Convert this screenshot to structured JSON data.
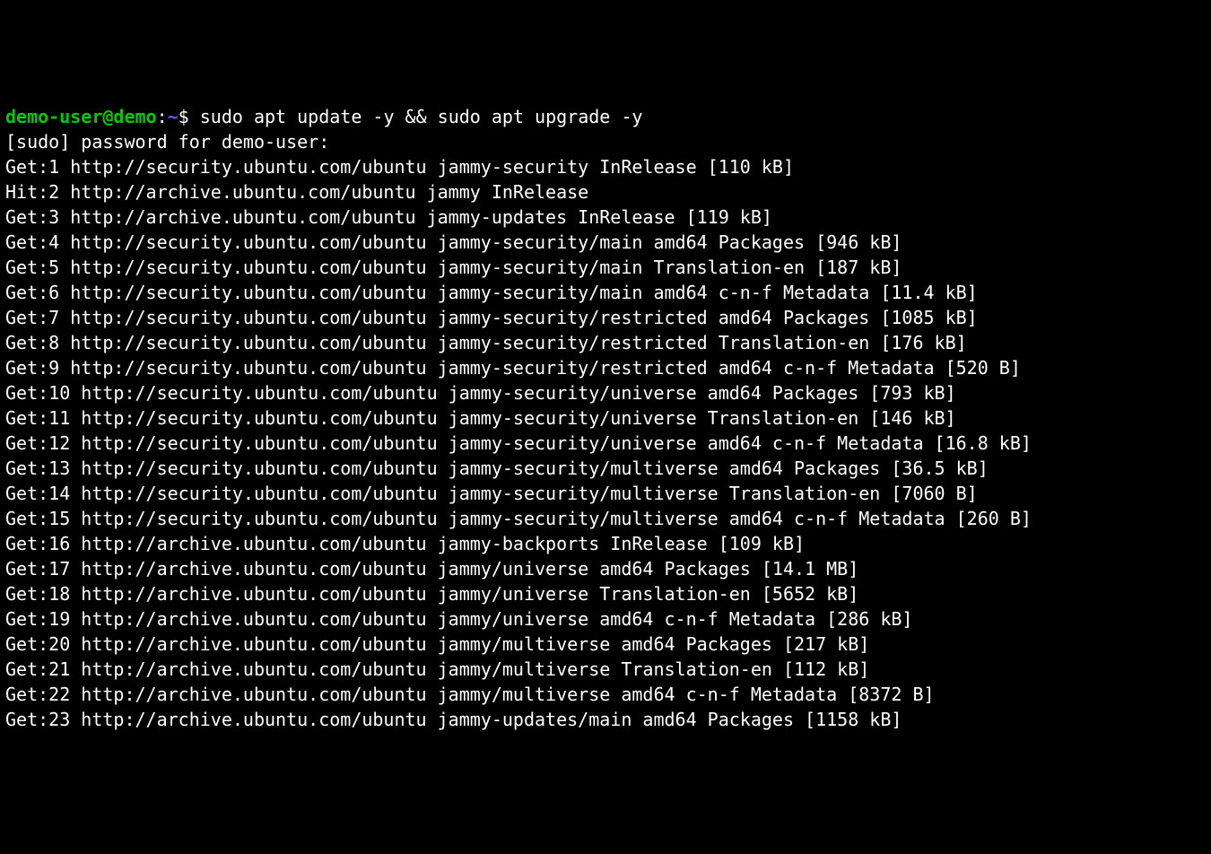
{
  "prompt": {
    "user_host": "demo-user@demo",
    "colon": ":",
    "path": "~",
    "dollar": "$ "
  },
  "command": "sudo apt update -y && sudo apt upgrade -y",
  "lines": [
    "[sudo] password for demo-user:",
    "Get:1 http://security.ubuntu.com/ubuntu jammy-security InRelease [110 kB]",
    "Hit:2 http://archive.ubuntu.com/ubuntu jammy InRelease",
    "Get:3 http://archive.ubuntu.com/ubuntu jammy-updates InRelease [119 kB]",
    "Get:4 http://security.ubuntu.com/ubuntu jammy-security/main amd64 Packages [946 kB]",
    "Get:5 http://security.ubuntu.com/ubuntu jammy-security/main Translation-en [187 kB]",
    "Get:6 http://security.ubuntu.com/ubuntu jammy-security/main amd64 c-n-f Metadata [11.4 kB]",
    "Get:7 http://security.ubuntu.com/ubuntu jammy-security/restricted amd64 Packages [1085 kB]",
    "Get:8 http://security.ubuntu.com/ubuntu jammy-security/restricted Translation-en [176 kB]",
    "Get:9 http://security.ubuntu.com/ubuntu jammy-security/restricted amd64 c-n-f Metadata [520 B]",
    "Get:10 http://security.ubuntu.com/ubuntu jammy-security/universe amd64 Packages [793 kB]",
    "Get:11 http://security.ubuntu.com/ubuntu jammy-security/universe Translation-en [146 kB]",
    "Get:12 http://security.ubuntu.com/ubuntu jammy-security/universe amd64 c-n-f Metadata [16.8 kB]",
    "Get:13 http://security.ubuntu.com/ubuntu jammy-security/multiverse amd64 Packages [36.5 kB]",
    "Get:14 http://security.ubuntu.com/ubuntu jammy-security/multiverse Translation-en [7060 B]",
    "Get:15 http://security.ubuntu.com/ubuntu jammy-security/multiverse amd64 c-n-f Metadata [260 B]",
    "Get:16 http://archive.ubuntu.com/ubuntu jammy-backports InRelease [109 kB]",
    "Get:17 http://archive.ubuntu.com/ubuntu jammy/universe amd64 Packages [14.1 MB]",
    "Get:18 http://archive.ubuntu.com/ubuntu jammy/universe Translation-en [5652 kB]",
    "Get:19 http://archive.ubuntu.com/ubuntu jammy/universe amd64 c-n-f Metadata [286 kB]",
    "Get:20 http://archive.ubuntu.com/ubuntu jammy/multiverse amd64 Packages [217 kB]",
    "Get:21 http://archive.ubuntu.com/ubuntu jammy/multiverse Translation-en [112 kB]",
    "Get:22 http://archive.ubuntu.com/ubuntu jammy/multiverse amd64 c-n-f Metadata [8372 B]",
    "Get:23 http://archive.ubuntu.com/ubuntu jammy-updates/main amd64 Packages [1158 kB]"
  ]
}
